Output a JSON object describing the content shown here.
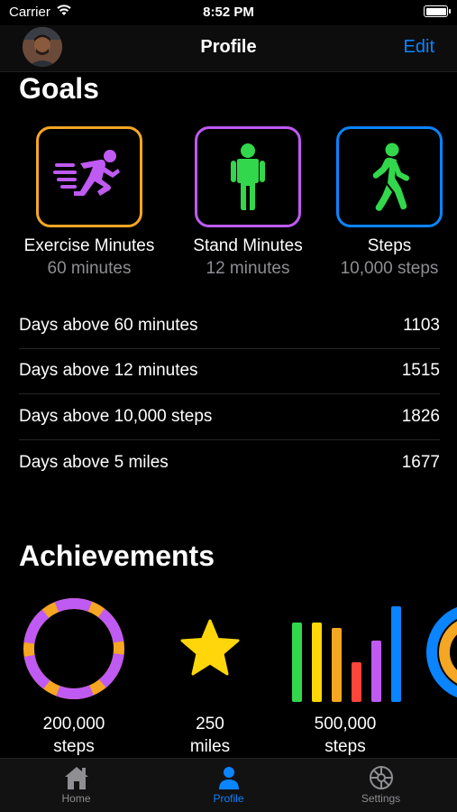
{
  "status_bar": {
    "carrier": "Carrier",
    "time": "8:52 PM"
  },
  "nav": {
    "title": "Profile",
    "edit_label": "Edit"
  },
  "goals": {
    "title": "Goals",
    "items": [
      {
        "name": "Exercise Minutes",
        "value": "60 minutes",
        "icon": "running-figure-icon",
        "border_color": "#f5a623",
        "icon_color": "#bf5af2"
      },
      {
        "name": "Stand Minutes",
        "value": "12 minutes",
        "icon": "standing-figure-icon",
        "border_color": "#bf5af2",
        "icon_color": "#32d74b"
      },
      {
        "name": "Steps",
        "value": "10,000 steps",
        "icon": "walking-figure-icon",
        "border_color": "#0a84ff",
        "icon_color": "#32d74b"
      }
    ]
  },
  "stats": [
    {
      "label": "Days above 60 minutes",
      "value": "1103"
    },
    {
      "label": "Days above 12 minutes",
      "value": "1515"
    },
    {
      "label": "Days above 10,000 steps",
      "value": "1826"
    },
    {
      "label": "Days above 5 miles",
      "value": "1677"
    }
  ],
  "achievements": {
    "title": "Achievements",
    "items": [
      {
        "line1": "200,000",
        "line2": "steps",
        "icon": "ring-badge-icon"
      },
      {
        "line1": "250",
        "line2": "miles",
        "icon": "star-badge-icon"
      },
      {
        "line1": "500,000",
        "line2": "steps",
        "icon": "bars-badge-icon"
      }
    ]
  },
  "tabs": [
    {
      "label": "Home",
      "icon": "house-icon",
      "active": false
    },
    {
      "label": "Profile",
      "icon": "person-icon",
      "active": true
    },
    {
      "label": "Settings",
      "icon": "gear-icon",
      "active": false
    }
  ],
  "colors": {
    "accent": "#0a84ff",
    "orange": "#f5a623",
    "purple": "#bf5af2",
    "green": "#32d74b",
    "yellow": "#ffd60a",
    "red": "#ff453a"
  }
}
